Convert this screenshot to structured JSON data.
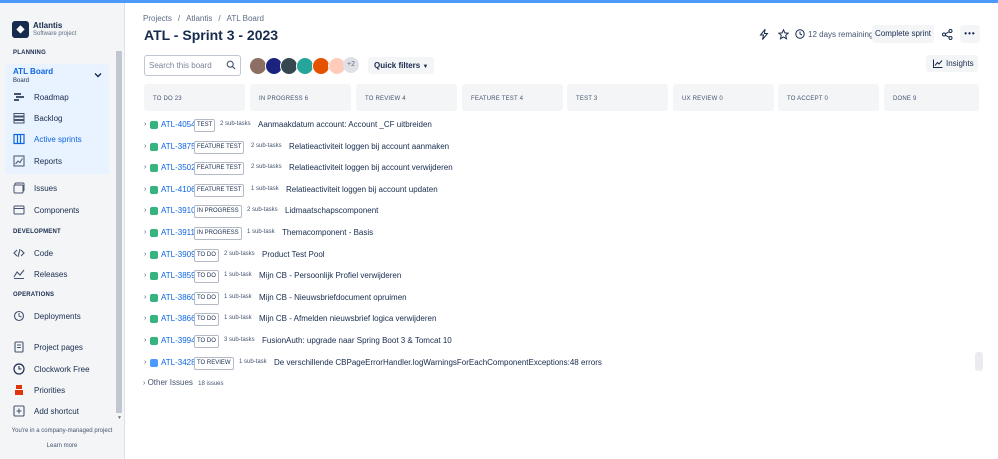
{
  "project": {
    "name": "Atlantis",
    "type": "Software project"
  },
  "sidebar": {
    "planning_heading": "PLANNING",
    "board_selector": {
      "title": "ATL Board",
      "subtitle": "Board"
    },
    "planning_items": [
      {
        "label": "Roadmap",
        "icon": "roadmap-icon"
      },
      {
        "label": "Backlog",
        "icon": "backlog-icon"
      },
      {
        "label": "Active sprints",
        "icon": "board-icon",
        "active": true
      },
      {
        "label": "Reports",
        "icon": "chart-icon"
      }
    ],
    "other_items": [
      {
        "label": "Issues",
        "icon": "issues-icon"
      },
      {
        "label": "Components",
        "icon": "components-icon"
      }
    ],
    "development_heading": "DEVELOPMENT",
    "development_items": [
      {
        "label": "Code",
        "icon": "code-icon"
      },
      {
        "label": "Releases",
        "icon": "releases-icon"
      }
    ],
    "operations_heading": "OPERATIONS",
    "operations_items": [
      {
        "label": "Deployments",
        "icon": "deployments-icon"
      }
    ],
    "bottom_items": [
      {
        "label": "Project pages",
        "icon": "pages-icon"
      },
      {
        "label": "Clockwork Free",
        "icon": "clock-icon"
      },
      {
        "label": "Priorities",
        "icon": "priorities-icon"
      },
      {
        "label": "Add shortcut",
        "icon": "add-shortcut-icon"
      }
    ],
    "footer_text": "You're in a company-managed project",
    "footer_link": "Learn more"
  },
  "breadcrumb": [
    "Projects",
    "Atlantis",
    "ATL Board"
  ],
  "page_title": "ATL - Sprint 3 - 2023",
  "header": {
    "days_remaining": "12 days remaining",
    "complete_sprint": "Complete sprint"
  },
  "toolbar": {
    "search_placeholder": "Search this board",
    "avatar_more": "+2",
    "quick_filters": "Quick filters",
    "insights": "Insights"
  },
  "columns": [
    "TO DO  23",
    "IN PROGRESS  6",
    "TO REVIEW  4",
    "FEATURE TEST  4",
    "TEST  3",
    "UX REVIEW  0",
    "TO ACCEPT  0",
    "DONE  9"
  ],
  "issues": [
    {
      "key": "ATL-4054",
      "status": "TEST",
      "subtasks": "2 sub-tasks",
      "summary": "Aanmaakdatum account: Account _CF uitbreiden"
    },
    {
      "key": "ATL-3875",
      "status": "FEATURE TEST",
      "subtasks": "2 sub-tasks",
      "summary": "Relatieactiviteit loggen bij account aanmaken"
    },
    {
      "key": "ATL-3502",
      "status": "FEATURE TEST",
      "subtasks": "2 sub-tasks",
      "summary": "Relatieactiviteit loggen bij account verwijderen"
    },
    {
      "key": "ATL-4106",
      "status": "FEATURE TEST",
      "subtasks": "1 sub-task",
      "summary": "Relatieactiviteit loggen bij account updaten"
    },
    {
      "key": "ATL-3910",
      "status": "IN PROGRESS",
      "subtasks": "2 sub-tasks",
      "summary": "Lidmaatschapscomponent"
    },
    {
      "key": "ATL-3911",
      "status": "IN PROGRESS",
      "subtasks": "1 sub-task",
      "summary": "Themacomponent - Basis"
    },
    {
      "key": "ATL-3909",
      "status": "TO DO",
      "subtasks": "2 sub-tasks",
      "summary": "Product Test Pool"
    },
    {
      "key": "ATL-3859",
      "status": "TO DO",
      "subtasks": "1 sub-task",
      "summary": "Mijn CB - Persoonlijk Profiel verwijderen"
    },
    {
      "key": "ATL-3860",
      "status": "TO DO",
      "subtasks": "1 sub-task",
      "summary": "Mijn CB - Nieuwsbriefdocument opruimen"
    },
    {
      "key": "ATL-3866",
      "status": "TO DO",
      "subtasks": "1 sub-task",
      "summary": "Mijn CB - Afmelden nieuwsbrief logica verwijderen"
    },
    {
      "key": "ATL-3994",
      "status": "TO DO",
      "subtasks": "3 sub-tasks",
      "summary": "FusionAuth: upgrade naar Spring Boot 3 & Tomcat 10"
    },
    {
      "key": "ATL-3428",
      "status": "TO REVIEW",
      "subtasks": "1 sub-task",
      "summary": "De verschillende CBPageErrorHandler.logWarningsForEachComponentExceptions:48 errors",
      "type": "task"
    }
  ],
  "other_issues": {
    "label": "Other Issues",
    "count": "18 issues"
  }
}
